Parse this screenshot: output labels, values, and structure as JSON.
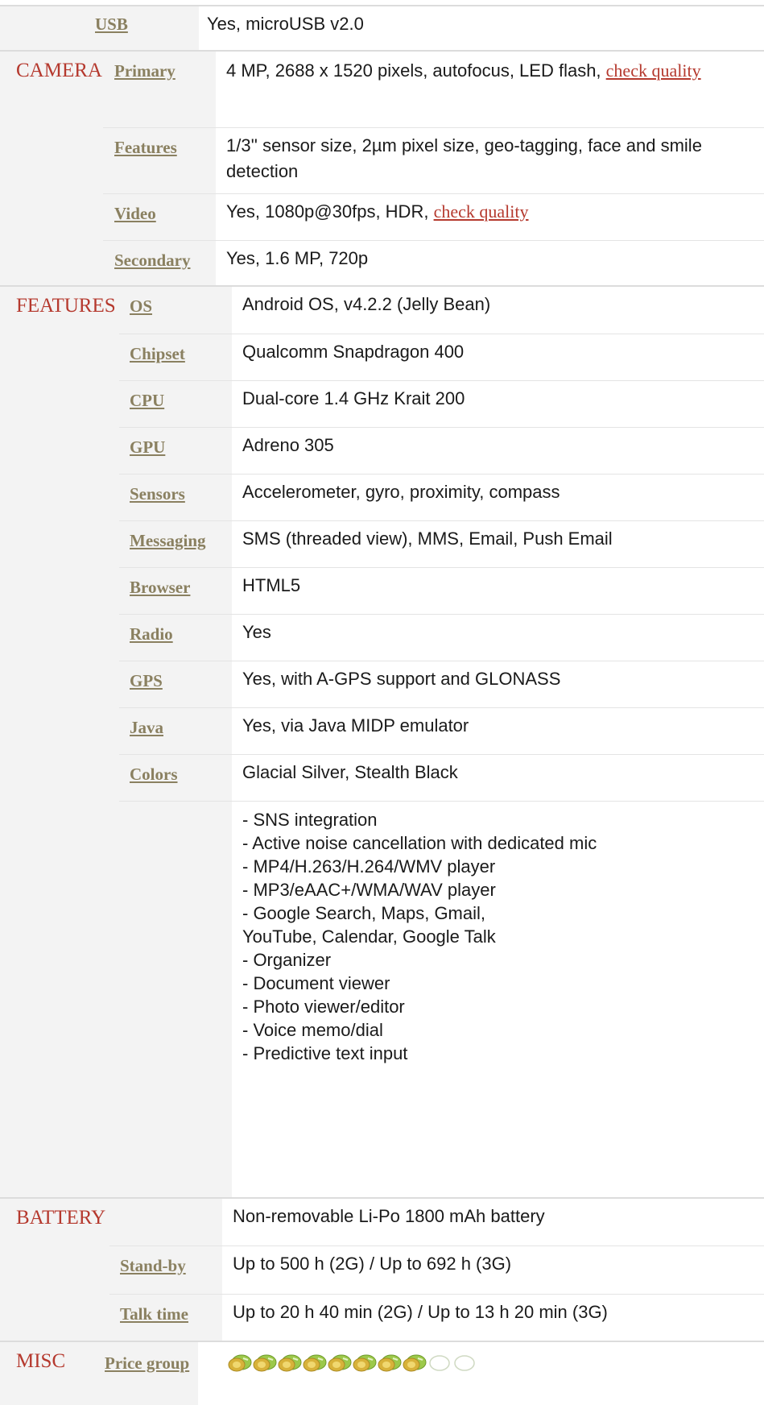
{
  "usb": {
    "label": "USB",
    "value": "Yes, microUSB v2.0"
  },
  "camera": {
    "title": "CAMERA",
    "rows": [
      {
        "label": "Primary",
        "value": "4 MP, 2688 x 1520 pixels, autofocus, LED flash,",
        "link": "check quality"
      },
      {
        "label": "Features",
        "value": "1/3'' sensor size, 2µm pixel size, geo-tagging, face and smile detection"
      },
      {
        "label": "Video",
        "value": "Yes, 1080p@30fps, HDR,",
        "link": "check quality"
      },
      {
        "label": "Secondary",
        "value": "Yes, 1.6 MP, 720p"
      }
    ]
  },
  "features": {
    "title": "FEATURES",
    "rows": [
      {
        "label": "OS",
        "value": "Android OS, v4.2.2 (Jelly Bean)"
      },
      {
        "label": "Chipset",
        "value": "Qualcomm Snapdragon 400"
      },
      {
        "label": "CPU",
        "value": "Dual-core 1.4 GHz Krait 200"
      },
      {
        "label": "GPU",
        "value": "Adreno 305"
      },
      {
        "label": "Sensors",
        "value": "Accelerometer, gyro, proximity, compass"
      },
      {
        "label": "Messaging",
        "value": "SMS (threaded view), MMS, Email, Push Email"
      },
      {
        "label": "Browser",
        "value": "HTML5"
      },
      {
        "label": "Radio",
        "value": "Yes"
      },
      {
        "label": "GPS",
        "value": "Yes, with A-GPS support and GLONASS"
      },
      {
        "label": "Java",
        "value": "Yes, via Java MIDP emulator"
      },
      {
        "label": "Colors",
        "value": "Glacial Silver, Stealth Black"
      }
    ],
    "extra_lines": [
      "- SNS integration",
      "- Active noise cancellation with dedicated mic",
      "- MP4/H.263/H.264/WMV player",
      "- MP3/eAAC+/WMA/WAV player",
      "- Google Search, Maps, Gmail,",
      "YouTube, Calendar, Google Talk",
      "- Organizer",
      "- Document viewer",
      "- Photo viewer/editor",
      "- Voice memo/dial",
      "- Predictive text input"
    ]
  },
  "battery": {
    "title": "BATTERY",
    "value": "Non-removable Li-Po 1800 mAh battery",
    "rows": [
      {
        "label": "Stand-by",
        "value": "Up to 500 h (2G) / Up to 692 h (3G)"
      },
      {
        "label": "Talk time",
        "value": "Up to 20 h 40 min (2G) / Up to 13 h 20 min (3G)"
      }
    ]
  },
  "misc": {
    "title": "MISC",
    "price_label": "Price group",
    "price_level": 8,
    "price_max": 10,
    "coin_icon": "money-coin-icon",
    "colors": {
      "coin_filled": "#9cc94a",
      "coin_gold": "#d8b23a",
      "coin_empty": "#cfd9c2"
    }
  },
  "colors": {
    "section_title": "#b5392e",
    "label": "#8a8060",
    "link": "#b5392e",
    "label_bg": "#f3f3f3"
  }
}
